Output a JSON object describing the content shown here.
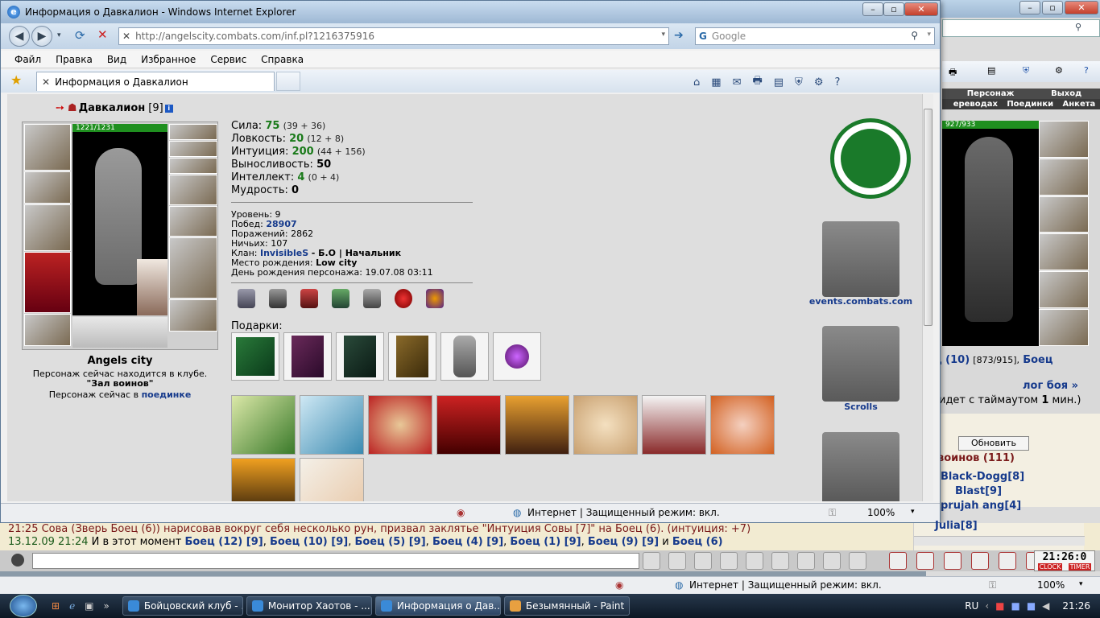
{
  "window": {
    "title": "Информация о Давкалион - Windows Internet Explorer"
  },
  "nav": {
    "url": "http://angelscity.combats.com/inf.pl?1216375916",
    "search_placeholder": "Google"
  },
  "menu": [
    "Файл",
    "Правка",
    "Вид",
    "Избранное",
    "Сервис",
    "Справка"
  ],
  "tab": {
    "label": "Информация о Давкалион"
  },
  "character": {
    "name": "Давкалион",
    "level": "[9]",
    "hp": "1221/1231",
    "city": "Angels city",
    "location_line1": "Персонаж сейчас находится в клубе.",
    "location_line2": "\"Зал воинов\"",
    "battle_prefix": "Персонаж сейчас в",
    "battle_link": "поединке"
  },
  "stats": [
    {
      "label": "Сила:",
      "value": "75",
      "detail": "(39 + 36)"
    },
    {
      "label": "Ловкость:",
      "value": "20",
      "detail": "(12 + 8)"
    },
    {
      "label": "Интуиция:",
      "value": "200",
      "detail": "(44 + 156)"
    },
    {
      "label": "Выносливость:",
      "value": "50",
      "detail": ""
    },
    {
      "label": "Интеллект:",
      "value": "4",
      "detail": "(0 + 4)"
    },
    {
      "label": "Мудрость:",
      "value": "0",
      "detail": ""
    }
  ],
  "info": {
    "level": "Уровень: 9",
    "wins_label": "Побед:",
    "wins": "28907",
    "losses": "Поражений: 2862",
    "draws": "Ничьих: 107",
    "clan_label": "Клан:",
    "clan_name": "InvisibleS",
    "clan_rest": "- Б.О | Начальник",
    "birthplace_label": "Место рождения:",
    "birthplace": "Low city",
    "birthday": "День рождения персонажа: 19.07.08 03:11"
  },
  "gifts_label": "Подарки:",
  "links": {
    "events": "events.combats.com",
    "scrolls": "Scrolls"
  },
  "statusbar": {
    "zone": "Интернет | Защищенный режим: вкл.",
    "zoom": "100%"
  },
  "bg": {
    "menu1": "Персонаж",
    "menu2": "Выход",
    "menu3": "ереводах",
    "menu4": "Поединки",
    "menu5": "Анкета",
    "hp": "927/933",
    "fighter_name": "ц (10)",
    "fighter_hp": "[873/915],",
    "fighter2": "Боец",
    "log_link": "лог боя »",
    "timeout_pre": "идет с таймаутом",
    "timeout_num": "1",
    "timeout_post": "мин.)",
    "refresh": "Обновить",
    "room": "воинов (111)",
    "users": [
      "Black-Dogg[8]",
      "Blast[9]",
      "prujah ang[4]",
      "Julia[8]"
    ]
  },
  "chat": {
    "line1": "21:25 Сова (Зверь Боец (6)) нарисовав вокруг себя несколько рун, призвал заклятье \"Интуиция Совы [7]\" на Боец (6). (интуиция: +7)",
    "line2_time": "13.12.09 21:24",
    "line2_text": "И в этот момент",
    "fighters": [
      "Боец (12) [9]",
      "Боец (10) [9]",
      "Боец (5) [9]",
      "Боец (4) [9]",
      "Боец (1) [9]",
      "Боец (9) [9]",
      "Боец (6)"
    ],
    "and": "и"
  },
  "clock": {
    "display": "21:26:0",
    "left": "CLOCK",
    "right": "TIMER"
  },
  "bottomstatus": {
    "zone": "Интернет | Защищенный режим: вкл.",
    "zoom": "100%"
  },
  "taskbar": {
    "items": [
      "Бойцовский клуб - ...",
      "Монитор Хаотов - ...",
      "Информация о Дав...",
      "Безымянный - Paint"
    ],
    "lang": "RU",
    "time": "21:26"
  },
  "colors": {
    "accent": "#1a7a1a",
    "link": "#163a8c",
    "hp": "#1f8f1f"
  }
}
